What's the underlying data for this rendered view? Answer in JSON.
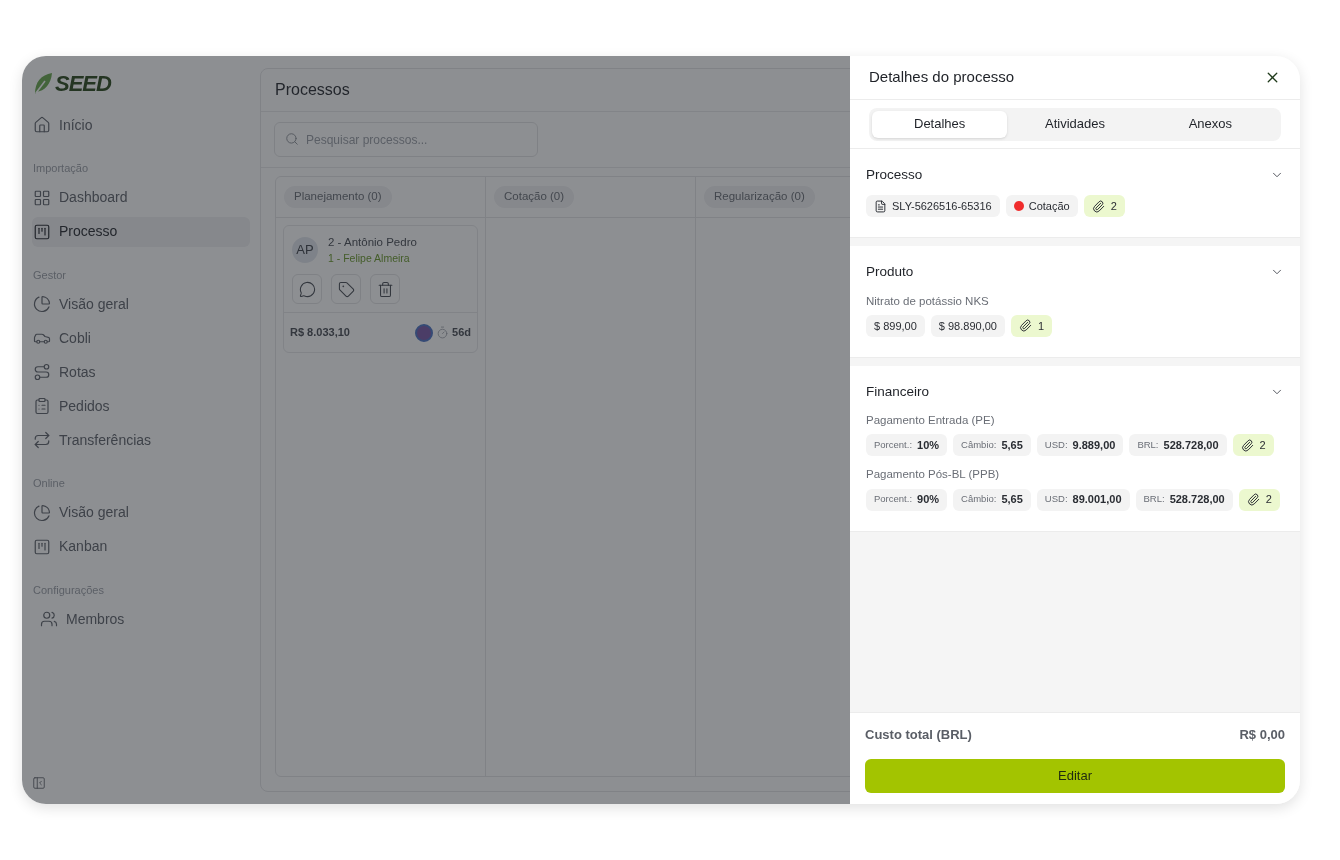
{
  "logo": {
    "text": "SEED"
  },
  "sidebar": {
    "sections": [
      {
        "items": [
          {
            "label": "Início",
            "selected": false
          }
        ]
      },
      {
        "title": "Importação",
        "items": [
          {
            "label": "Dashboard",
            "selected": false
          },
          {
            "label": "Processo",
            "selected": true
          }
        ]
      },
      {
        "title": "Gestor",
        "items": [
          {
            "label": "Visão geral",
            "selected": false
          },
          {
            "label": "Cobli",
            "selected": false
          },
          {
            "label": "Rotas",
            "selected": false
          },
          {
            "label": "Pedidos",
            "selected": false
          },
          {
            "label": "Transferências",
            "selected": false
          }
        ]
      },
      {
        "title": "Online",
        "items": [
          {
            "label": "Visão geral",
            "selected": false
          },
          {
            "label": "Kanban",
            "selected": false
          }
        ]
      },
      {
        "title": "Configurações",
        "items": [
          {
            "label": "Membros",
            "selected": false
          }
        ]
      }
    ]
  },
  "main": {
    "title": "Processos",
    "search": {
      "placeholder": "Pesquisar processos..."
    },
    "columns": [
      {
        "label": "Planejamento (0)",
        "cards": [
          {
            "initials": "AP",
            "title": "2 - Antônio Pedro",
            "subtitle": "1 - Felipe Almeira",
            "amount": "R$ 8.033,10",
            "days": "56d"
          }
        ]
      },
      {
        "label": "Cotação (0)"
      },
      {
        "label": "Regularização (0)"
      }
    ]
  },
  "drawer": {
    "title": "Detalhes do processo",
    "tabs": [
      {
        "label": "Detalhes",
        "selected": true
      },
      {
        "label": "Atividades",
        "selected": false
      },
      {
        "label": "Anexos",
        "selected": false
      }
    ],
    "sections": [
      {
        "title": "Processo",
        "expanded": true,
        "groups": [
          {
            "chips": [
              {
                "kind": "document",
                "value": "SLY-5626516-65316"
              },
              {
                "kind": "status",
                "value": "Cotação",
                "color": "#f02d2d"
              },
              {
                "kind": "attachment",
                "value": "2"
              }
            ]
          }
        ]
      },
      {
        "title": "Produto",
        "expanded": true,
        "groups": [
          {
            "label": "Nitrato de potássio NKS",
            "chips": [
              {
                "kind": "value",
                "value": "$ 899,00"
              },
              {
                "kind": "value",
                "value": "$ 98.890,00"
              },
              {
                "kind": "attachment",
                "value": "1"
              }
            ]
          }
        ]
      },
      {
        "title": "Financeiro",
        "expanded": true,
        "groups": [
          {
            "label": "Pagamento Entrada (PE)",
            "chips": [
              {
                "kind": "field",
                "label": "Porcent.:",
                "value": "10%"
              },
              {
                "kind": "field",
                "label": "Câmbio:",
                "value": "5,65"
              },
              {
                "kind": "field",
                "label": "USD:",
                "value": "9.889,00"
              },
              {
                "kind": "field",
                "label": "BRL:",
                "value": "528.728,00"
              },
              {
                "kind": "attachment",
                "value": "2"
              }
            ]
          },
          {
            "label": "Pagamento Pós-BL (PPB)",
            "chips": [
              {
                "kind": "field",
                "label": "Porcent.:",
                "value": "90%"
              },
              {
                "kind": "field",
                "label": "Câmbio:",
                "value": "5,65"
              },
              {
                "kind": "field",
                "label": "USD:",
                "value": "89.001,00"
              },
              {
                "kind": "field",
                "label": "BRL:",
                "value": "528.728,00"
              },
              {
                "kind": "attachment",
                "value": "2"
              }
            ]
          }
        ]
      }
    ],
    "total": {
      "label": "Custo total (BRL)",
      "value": "R$ 0,00"
    },
    "button": "Editar"
  }
}
